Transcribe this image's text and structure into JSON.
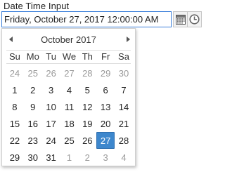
{
  "field": {
    "label": "Date Time Input",
    "value": "Friday, October 27, 2017 12:00:00 AM"
  },
  "buttons": {
    "calendar_icon": "calendar-icon",
    "clock_icon": "clock-icon"
  },
  "calendar": {
    "month_title": "October 2017",
    "weekdays": [
      "Su",
      "Mo",
      "Tu",
      "We",
      "Th",
      "Fr",
      "Sa"
    ],
    "weeks": [
      [
        {
          "d": "24",
          "other": true
        },
        {
          "d": "25",
          "other": true
        },
        {
          "d": "26",
          "other": true
        },
        {
          "d": "27",
          "other": true
        },
        {
          "d": "28",
          "other": true
        },
        {
          "d": "29",
          "other": true
        },
        {
          "d": "30",
          "other": true
        }
      ],
      [
        {
          "d": "1"
        },
        {
          "d": "2"
        },
        {
          "d": "3"
        },
        {
          "d": "4"
        },
        {
          "d": "5"
        },
        {
          "d": "6"
        },
        {
          "d": "7"
        }
      ],
      [
        {
          "d": "8"
        },
        {
          "d": "9"
        },
        {
          "d": "10"
        },
        {
          "d": "11"
        },
        {
          "d": "12"
        },
        {
          "d": "13"
        },
        {
          "d": "14"
        }
      ],
      [
        {
          "d": "15"
        },
        {
          "d": "16"
        },
        {
          "d": "17"
        },
        {
          "d": "18"
        },
        {
          "d": "19"
        },
        {
          "d": "20"
        },
        {
          "d": "21"
        }
      ],
      [
        {
          "d": "22"
        },
        {
          "d": "23"
        },
        {
          "d": "24"
        },
        {
          "d": "25"
        },
        {
          "d": "26"
        },
        {
          "d": "27",
          "selected": true
        },
        {
          "d": "28"
        }
      ],
      [
        {
          "d": "29"
        },
        {
          "d": "30"
        },
        {
          "d": "31"
        },
        {
          "d": "1",
          "other": true
        },
        {
          "d": "2",
          "other": true
        },
        {
          "d": "3",
          "other": true
        },
        {
          "d": "4",
          "other": true
        }
      ]
    ],
    "colors": {
      "selected_bg": "#3d87cd",
      "focus_border": "#3b7fd9",
      "other_month_text": "#9a9a9a"
    }
  }
}
